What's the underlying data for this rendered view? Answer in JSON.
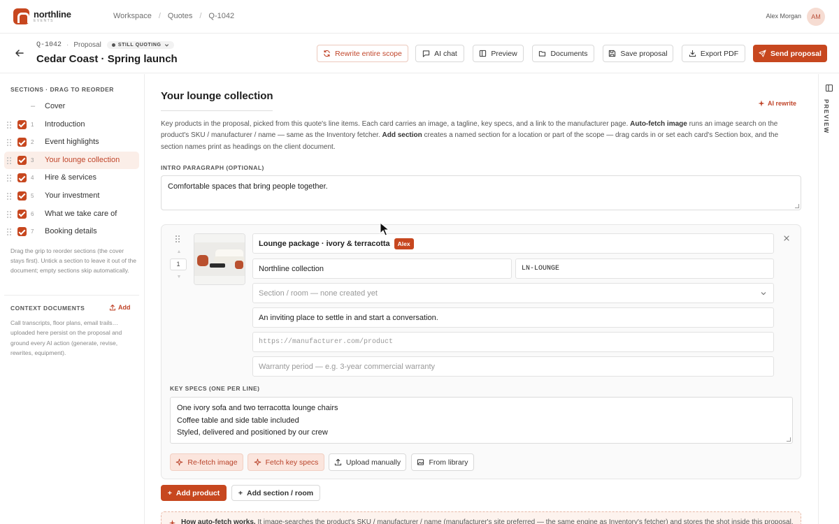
{
  "brand": {
    "name": "northline",
    "sub": "EVENTS",
    "accent": "#c7471f"
  },
  "breadcrumb": [
    "Workspace",
    "Quotes",
    "Q-1042"
  ],
  "user": {
    "name": "Alex Morgan",
    "initials": "AM"
  },
  "quote": {
    "id": "Q-1042",
    "type": "Proposal",
    "status": "STILL QUOTING",
    "title": "Cedar Coast · Spring launch"
  },
  "toolbar": {
    "rewrite_scope": "Rewrite entire scope",
    "ai_chat": "AI chat",
    "preview": "Preview",
    "documents": "Documents",
    "save": "Save proposal",
    "export": "Export PDF",
    "send": "Send proposal"
  },
  "sidebar": {
    "heading": "SECTIONS · DRAG TO REORDER",
    "cover": {
      "dash": "–",
      "label": "Cover"
    },
    "items": [
      {
        "num": "1",
        "label": "Introduction"
      },
      {
        "num": "2",
        "label": "Event highlights"
      },
      {
        "num": "3",
        "label": "Your lounge collection"
      },
      {
        "num": "4",
        "label": "Hire & services"
      },
      {
        "num": "5",
        "label": "Your investment"
      },
      {
        "num": "6",
        "label": "What we take care of"
      },
      {
        "num": "7",
        "label": "Booking details"
      }
    ],
    "help": "Drag the grip to reorder sections (the cover stays first). Untick a section to leave it out of the document; empty sections skip automatically.",
    "context_heading": "CONTEXT DOCUMENTS",
    "context_add": "Add",
    "context_help": "Call transcripts, floor plans, email trails… uploaded here persist on the proposal and ground every AI action (generate, revise, rewrites, equipment)."
  },
  "main": {
    "title": "Your lounge collection",
    "ai_rewrite": "AI rewrite",
    "desc_1": "Key products in the proposal, picked from this quote's line items. Each card carries an image, a tagline, key specs, and a link to the manufacturer page. ",
    "desc_b1": "Auto-fetch image",
    "desc_2": " runs an image search on the product's SKU / manufacturer / name — same as the Inventory fetcher. ",
    "desc_b2": "Add section",
    "desc_3": " creates a named section for a location or part of the scope — drag cards in or set each card's Section box, and the section names print as headings on the client document.",
    "intro_label": "INTRO PARAGRAPH (OPTIONAL)",
    "intro_value": "Comfortable spaces that bring people together.",
    "add_product": "Add product",
    "add_section": "Add section / room",
    "note_bold": "How auto-fetch works.",
    "note_text": " It image-searches the product's SKU / manufacturer / name (manufacturer's site preferred — the same engine as Inventory's fetcher) and stores the shot inside this proposal."
  },
  "product": {
    "order": "1",
    "name": "Lounge package · ivory & terracotta",
    "badge": "Alex",
    "manufacturer": "Northline collection",
    "sku": "LN-LOUNGE",
    "section_placeholder": "Section / room — none created yet",
    "tagline": "An inviting place to settle in and start a conversation.",
    "url_placeholder": "https://manufacturer.com/product",
    "warranty_placeholder": "Warranty period — e.g. 3-year commercial warranty",
    "specs_label": "KEY SPECS (ONE PER LINE)",
    "specs": [
      "One ivory sofa and two terracotta lounge chairs",
      "Coffee table and side table included",
      "Styled, delivered and positioned by our crew"
    ],
    "refetch_image": "Re-fetch image",
    "fetch_specs": "Fetch key specs",
    "upload": "Upload manually",
    "library": "From library"
  },
  "rail": {
    "label": "PREVIEW"
  }
}
